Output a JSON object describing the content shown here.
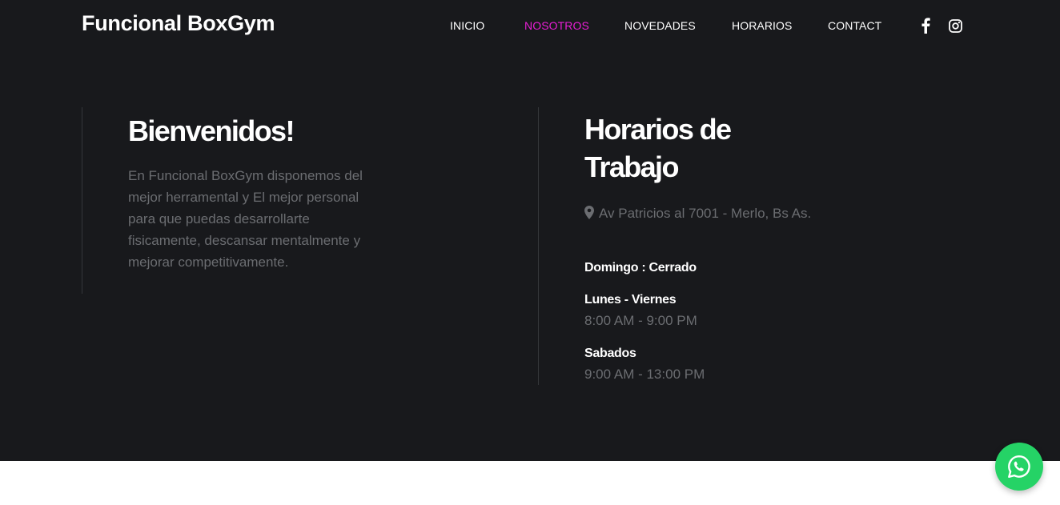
{
  "header": {
    "brand": "Funcional BoxGym",
    "nav": [
      "INICIO",
      "NOSOTROS",
      "NOVEDADES",
      "HORARIOS",
      "CONTACT"
    ],
    "active_item": "NOSOTROS",
    "social_icons": [
      "facebook-icon",
      "instagram-icon"
    ]
  },
  "welcome": {
    "title": "Bienvenidos!",
    "text": "En Funcional BoxGym disponemos del mejor herramental y El mejor personal para que puedas desarrollarte fisicamente, descansar mentalmente y mejorar competitivamente."
  },
  "schedule": {
    "title_line1": "Horarios de",
    "title_line2": "Trabajo",
    "address": "Av Patricios al 7001 - Merlo, Bs As.",
    "closed": "Domingo : Cerrado",
    "weekdays_label": "Lunes - Viernes",
    "weekdays_hours": "8:00 AM - 9:00 PM",
    "saturday_label": "Sabados",
    "saturday_hours": "9:00 AM - 13:00 PM"
  },
  "colors": {
    "background": "#18191c",
    "accent": "#e91ed6",
    "muted_text": "#6b6d71",
    "whatsapp": "#25d366"
  },
  "floating": {
    "icon": "whatsapp-icon"
  }
}
